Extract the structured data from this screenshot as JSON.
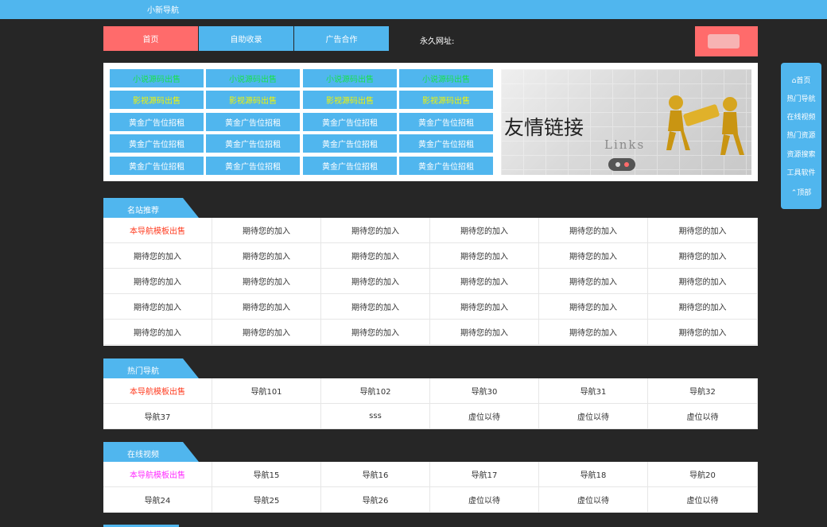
{
  "topbar": {
    "brand": "小新导航"
  },
  "nav": {
    "home": "首页",
    "self_submit": "自助收录",
    "ad_coop": "广告合作",
    "permanent_url": "永久网址:"
  },
  "banner": {
    "ads": [
      [
        "小说源码出售",
        "小说源码出售",
        "小说源码出售",
        "小说源码出售"
      ],
      [
        "影视源码出售",
        "影视源码出售",
        "影视源码出售",
        "影视源码出售"
      ],
      [
        "黄金广告位招租",
        "黄金广告位招租",
        "黄金广告位招租",
        "黄金广告位招租"
      ],
      [
        "黄金广告位招租",
        "黄金广告位招租",
        "黄金广告位招租",
        "黄金广告位招租"
      ],
      [
        "黄金广告位招租",
        "黄金广告位招租",
        "黄金广告位招租",
        "黄金广告位招租"
      ]
    ],
    "slide_title": "友情链接",
    "slide_sub": "Links"
  },
  "sidefloat": {
    "home": "首页",
    "items": [
      "热门导航",
      "在线视频",
      "热门资源",
      "资源搜索",
      "工具软件"
    ],
    "top": "顶部"
  },
  "sections": [
    {
      "title": "名站推荐",
      "rows": [
        [
          "本导航模板出售",
          "期待您的加入",
          "期待您的加入",
          "期待您的加入",
          "期待您的加入",
          "期待您的加入"
        ],
        [
          "期待您的加入",
          "期待您的加入",
          "期待您的加入",
          "期待您的加入",
          "期待您的加入",
          "期待您的加入"
        ],
        [
          "期待您的加入",
          "期待您的加入",
          "期待您的加入",
          "期待您的加入",
          "期待您的加入",
          "期待您的加入"
        ],
        [
          "期待您的加入",
          "期待您的加入",
          "期待您的加入",
          "期待您的加入",
          "期待您的加入",
          "期待您的加入"
        ],
        [
          "期待您的加入",
          "期待您的加入",
          "期待您的加入",
          "期待您的加入",
          "期待您的加入",
          "期待您的加入"
        ]
      ]
    },
    {
      "title": "热门导航",
      "rows": [
        [
          "本导航模板出售",
          "导航101",
          "导航102",
          "导航30",
          "导航31",
          "导航32"
        ],
        [
          "导航37",
          "",
          "sss",
          "虚位以待",
          "虚位以待",
          "虚位以待"
        ]
      ]
    },
    {
      "title": "在线视频",
      "rows": [
        [
          "本导航模板出售",
          "导航15",
          "导航16",
          "导航17",
          "导航18",
          "导航20"
        ],
        [
          "导航24",
          "导航25",
          "导航26",
          "虚位以待",
          "虚位以待",
          "虚位以待"
        ]
      ]
    }
  ],
  "colors": {
    "accent": "#50b6ee",
    "active": "#ff6b6b",
    "bg": "#262626"
  }
}
